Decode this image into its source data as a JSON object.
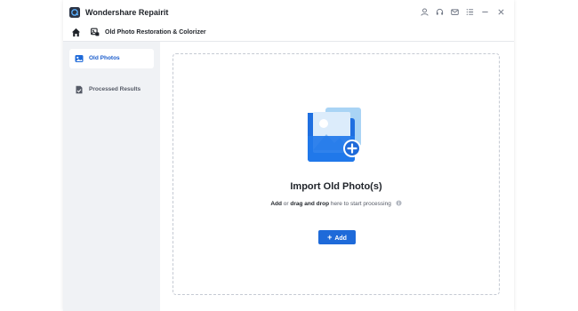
{
  "app": {
    "title": "Wondershare Repairit"
  },
  "window_controls": [
    "user-icon",
    "headset-icon",
    "mail-icon",
    "menu-icon",
    "minimize-icon",
    "close-icon"
  ],
  "breadcrumb": {
    "label": "Old Photo Restoration & Colorizer"
  },
  "sidebar": {
    "items": [
      {
        "label": "Old Photos",
        "icon": "old-photos-icon",
        "active": true
      },
      {
        "label": "Processed Results",
        "icon": "processed-results-icon",
        "active": false
      }
    ]
  },
  "main": {
    "import_title": "Import Old Photo(s)",
    "hint": {
      "part1": "Add",
      "part2": " or ",
      "part3": "drag and drop",
      "part4": " here to start processing"
    },
    "add_button": {
      "plus": "+",
      "label": "Add"
    }
  },
  "colors": {
    "accent": "#1e6ad9",
    "sidebar_bg": "#f0f2f5",
    "active_text": "#1a5ccc"
  }
}
